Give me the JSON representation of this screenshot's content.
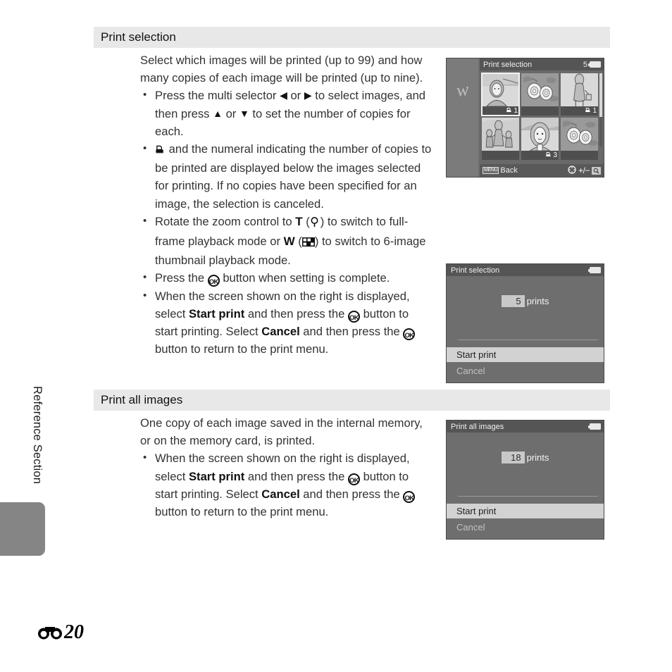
{
  "page": {
    "side_label": "Reference Section",
    "folio_number": "20",
    "folio_icon": "binoculars-icon"
  },
  "sections": [
    {
      "id": "print-selection",
      "heading": "Print selection",
      "intro": "Select which images will be printed (up to 99) and how many copies of each image will be printed (up to nine).",
      "bullets": [
        {
          "parts": [
            {
              "t": "text",
              "v": "Press the multi selector "
            },
            {
              "t": "glyph",
              "v": "left-triangle-icon"
            },
            {
              "t": "text",
              "v": " or "
            },
            {
              "t": "glyph",
              "v": "right-triangle-icon"
            },
            {
              "t": "text",
              "v": " to select images, and then press "
            },
            {
              "t": "glyph",
              "v": "up-triangle-icon"
            },
            {
              "t": "text",
              "v": " or "
            },
            {
              "t": "glyph",
              "v": "down-triangle-icon"
            },
            {
              "t": "text",
              "v": " to set the number of copies for each."
            }
          ]
        },
        {
          "parts": [
            {
              "t": "glyph",
              "v": "print-order-icon"
            },
            {
              "t": "text",
              "v": " and the numeral indicating the number of copies to be printed are displayed below the images selected for printing. If no copies have been specified for an image, the selection is canceled."
            }
          ]
        },
        {
          "parts": [
            {
              "t": "text",
              "v": "Rotate the zoom control to "
            },
            {
              "t": "bold",
              "v": "T"
            },
            {
              "t": "text",
              "v": " ("
            },
            {
              "t": "glyph",
              "v": "magnifier-icon"
            },
            {
              "t": "text",
              "v": ") to switch to full-frame playback mode or "
            },
            {
              "t": "bold",
              "v": "W"
            },
            {
              "t": "text",
              "v": " ("
            },
            {
              "t": "glyph",
              "v": "thumbnail-grid-icon"
            },
            {
              "t": "text",
              "v": ") to switch to 6-image thumbnail playback mode."
            }
          ]
        },
        {
          "parts": [
            {
              "t": "text",
              "v": "Press the "
            },
            {
              "t": "glyph",
              "v": "ok-button-icon"
            },
            {
              "t": "text",
              "v": " button when setting is complete."
            }
          ]
        },
        {
          "parts": [
            {
              "t": "text",
              "v": "When the screen shown on the right is displayed, select "
            },
            {
              "t": "bold",
              "v": "Start print"
            },
            {
              "t": "text",
              "v": " and then press the "
            },
            {
              "t": "glyph",
              "v": "ok-button-icon"
            },
            {
              "t": "text",
              "v": " button to start printing. Select "
            },
            {
              "t": "bold",
              "v": "Cancel"
            },
            {
              "t": "text",
              "v": " and then press the "
            },
            {
              "t": "glyph",
              "v": "ok-button-icon"
            },
            {
              "t": "text",
              "v": " button to return to the print menu."
            }
          ]
        }
      ]
    },
    {
      "id": "print-all-images",
      "heading": "Print all images",
      "intro": "One copy of each image saved in the internal memory, or on the memory card, is printed.",
      "bullets": [
        {
          "parts": [
            {
              "t": "text",
              "v": "When the screen shown on the right is displayed, select "
            },
            {
              "t": "bold",
              "v": "Start print"
            },
            {
              "t": "text",
              "v": " and then press the "
            },
            {
              "t": "glyph",
              "v": "ok-button-icon"
            },
            {
              "t": "text",
              "v": " button to start printing. Select "
            },
            {
              "t": "bold",
              "v": "Cancel"
            },
            {
              "t": "text",
              "v": " and then press the "
            },
            {
              "t": "glyph",
              "v": "ok-button-icon"
            },
            {
              "t": "text",
              "v": " button to return to the print menu."
            }
          ]
        }
      ]
    }
  ],
  "screens": {
    "grid": {
      "title": "Print selection",
      "count": "5",
      "battery_icon": "battery-full-icon",
      "thumbnails": [
        {
          "subject": "person-portrait-outdoor",
          "copies": "1",
          "selected": true
        },
        {
          "subject": "flowers",
          "copies": "",
          "selected": false
        },
        {
          "subject": "woman-with-bag",
          "copies": "1",
          "selected": false
        },
        {
          "subject": "family-group",
          "copies": "",
          "selected": false
        },
        {
          "subject": "woman-closeup",
          "copies": "3",
          "selected": false
        },
        {
          "subject": "flowers-two",
          "copies": "",
          "selected": false
        }
      ],
      "back_chip": "MENU",
      "back_label": "Back",
      "multi_selector_icon": "multi-selector-icon",
      "plus_minus": "+/−",
      "zoom_icon": "magnifier-icon"
    },
    "selection_confirm": {
      "title": "Print selection",
      "battery_icon": "battery-full-icon",
      "count": "5",
      "count_unit": "prints",
      "options": [
        {
          "label": "Start print",
          "highlighted": true
        },
        {
          "label": "Cancel",
          "highlighted": false
        }
      ]
    },
    "all_confirm": {
      "title": "Print all images",
      "battery_icon": "battery-full-icon",
      "count": "18",
      "count_unit": "prints",
      "options": [
        {
          "label": "Start print",
          "highlighted": true
        },
        {
          "label": "Cancel",
          "highlighted": false
        }
      ]
    }
  },
  "colors": {
    "section_header_bg": "#e8e8e8",
    "screen_bg": "#6e6e6e",
    "screen_titlebar": "#555555",
    "highlight": "#d2d2d2",
    "side_tab": "#858585",
    "body_text": "#333333"
  }
}
